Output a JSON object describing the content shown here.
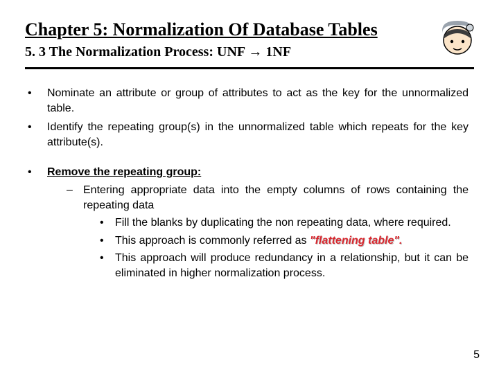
{
  "header": {
    "title": "Chapter 5: Normalization Of Database Tables",
    "subtitle_prefix": "5. 3 The Normalization Process: UNF ",
    "subtitle_arrow": "→",
    "subtitle_suffix": " 1NF"
  },
  "bullets": {
    "b1": "Nominate an attribute or group of attributes to act as the key for the unnormalized table.",
    "b2": "Identify the repeating group(s) in the unnormalized table which repeats for the key attribute(s).",
    "b3_title": "Remove the repeating group:",
    "b3_sub1": "Entering appropriate data into the empty columns of rows containing the repeating data",
    "b3_sub1_a": "Fill the blanks by duplicating the non repeating data, where required.",
    "b3_sub1_b_prefix": "This approach is commonly referred as ",
    "b3_sub1_b_em": "\"flattening table\".",
    "b3_sub1_c": "This approach will produce redundancy in a relationship, but it can be eliminated in higher normalization process."
  },
  "page_number": "5",
  "colors": {
    "accent_red": "#d8272e"
  }
}
